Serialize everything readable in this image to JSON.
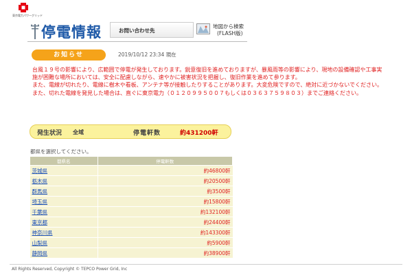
{
  "header": {
    "logo_text": "東京電力パワーグリッド",
    "title": "停電情報",
    "contact_label": "お問い合わせ先",
    "map_search_line1": "地図から検索",
    "map_search_line2": "(FLASH版)"
  },
  "notice": {
    "badge": "お知らせ",
    "timestamp": "2019/10/12 23:34 現在",
    "paragraphs": [
      "台風１９号の影響により、広範囲で停電が発生しております。鋭意復旧を進めておりますが、暴風雨等の影響により、現地の設備確認や工事実施が困難な場所においては、安全に配慮しながら、速やかに被害状況を把握し、復旧作業を進めて参ります。",
      "また、電線が切れたり、電線に樹木や看板、アンテナ等が接触したりすることがあります。大変危険ですので、絶対に近づかないでください。また、切れた電線を発見した場合は、直ぐに東京電力（０１２０９９５００７もしくは０３６３７５９８０３）までご連絡ください。"
    ]
  },
  "status": {
    "label": "発生状況",
    "area": "全域",
    "count_label": "停電軒数",
    "count_value": "約431200軒"
  },
  "select_hint": "都県を選択してください。",
  "table": {
    "headers": [
      "都県名",
      "停電軒数"
    ],
    "rows": [
      {
        "name": "茨城県",
        "count": "約46800軒"
      },
      {
        "name": "栃木県",
        "count": "約20500軒"
      },
      {
        "name": "群馬県",
        "count": "約3500軒"
      },
      {
        "name": "埼玉県",
        "count": "約15800軒"
      },
      {
        "name": "千葉県",
        "count": "約132100軒"
      },
      {
        "name": "東京都",
        "count": "約24400軒"
      },
      {
        "name": "神奈川県",
        "count": "約143300軒"
      },
      {
        "name": "山梨県",
        "count": "約5900軒"
      },
      {
        "name": "静岡県",
        "count": "約38900軒"
      }
    ]
  },
  "footer": "All Rights Reserved, Copyright © TEPCO Power Grid, Inc",
  "colors": {
    "accent_blue": "#1f5aa8",
    "notice_red": "#e02020",
    "badge_orange": "#f5a31a",
    "status_yellow": "#fbf29d",
    "logo_red": "#e60012"
  },
  "icons": {
    "header": "utility-pole-icon",
    "map": "map-icon",
    "logo": "tepco-logo"
  }
}
